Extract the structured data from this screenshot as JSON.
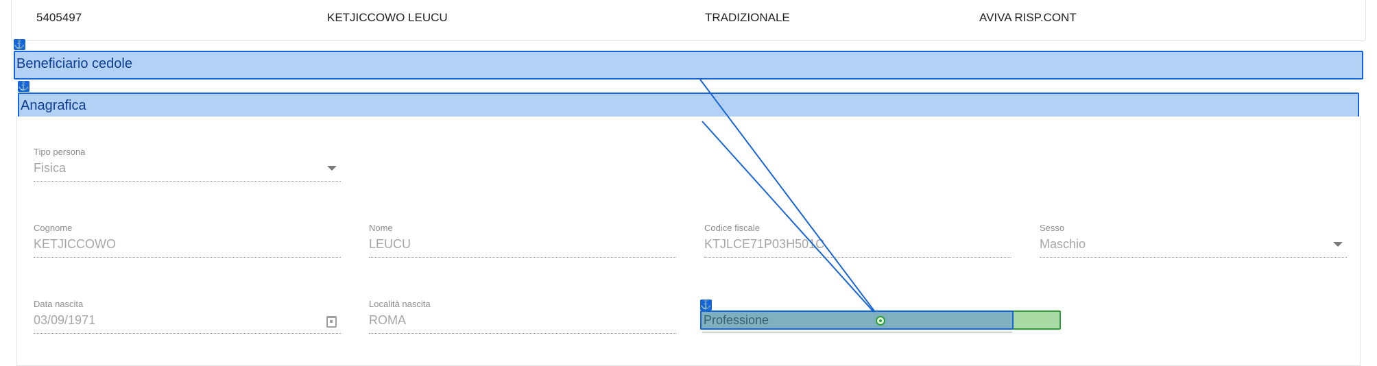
{
  "summary": {
    "code": "5405497",
    "name": "KETJICCOWO LEUCU",
    "type": "TRADIZIONALE",
    "product": "AVIVA RISP.CONT"
  },
  "sections": {
    "beneficiario": "Beneficiario cedole",
    "anagrafica": "Anagrafica"
  },
  "icons": {
    "anchor": "anchor-icon",
    "dropdown": "chevron-down-icon",
    "calendar": "calendar-icon",
    "target": "target-icon"
  },
  "colors": {
    "highlight_blue": "#b3d1f5",
    "highlight_border": "#1565d8",
    "green": "#2e9e3a"
  },
  "form": {
    "tipo_persona": {
      "label": "Tipo persona",
      "value": "Fisica"
    },
    "cognome": {
      "label": "Cognome",
      "value": "KETJICCOWO"
    },
    "nome": {
      "label": "Nome",
      "value": "LEUCU"
    },
    "codice_fiscale": {
      "label": "Codice fiscale",
      "value": "KTJLCE71P03H501C"
    },
    "sesso": {
      "label": "Sesso",
      "value": "Maschio"
    },
    "data_nascita": {
      "label": "Data nascita",
      "value": "03/09/1971"
    },
    "localita_nascita": {
      "label": "Località nascita",
      "value": "ROMA"
    },
    "professione": {
      "placeholder": "Professione"
    }
  }
}
